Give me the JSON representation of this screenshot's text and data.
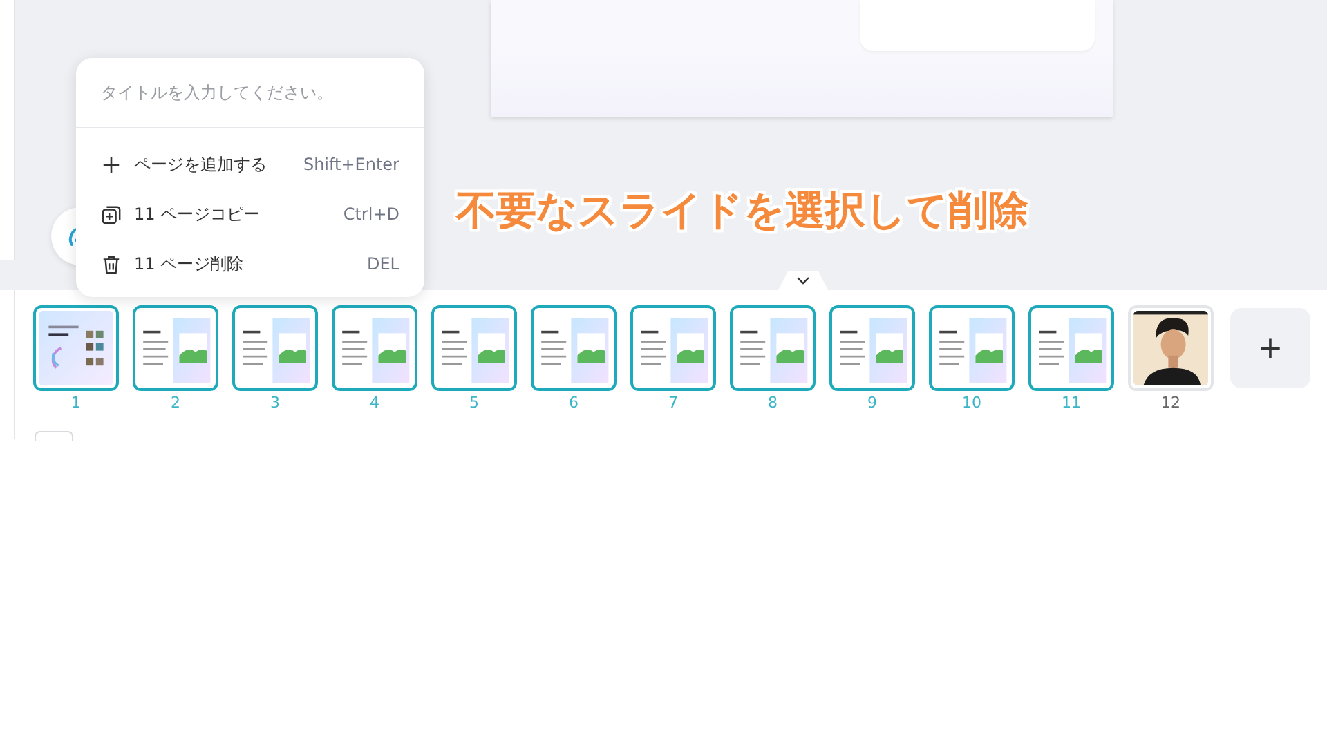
{
  "menu": {
    "title_field": {
      "placeholder": "タイトルを入力してください。"
    },
    "items": [
      {
        "kind": "add",
        "label": "ページを追加する",
        "shortcut": "Shift+Enter"
      },
      {
        "kind": "copy",
        "label": "11 ページコピー",
        "shortcut": "Ctrl+D"
      },
      {
        "kind": "delete",
        "label": "11 ページ削除",
        "shortcut": "DEL"
      }
    ]
  },
  "annotation": "不要なスライドを選択して削除",
  "slides": [
    {
      "number": "1",
      "kind": "cover",
      "selected": true
    },
    {
      "number": "2",
      "kind": "content",
      "selected": true
    },
    {
      "number": "3",
      "kind": "content",
      "selected": true
    },
    {
      "number": "4",
      "kind": "content",
      "selected": true
    },
    {
      "number": "5",
      "kind": "content",
      "selected": true
    },
    {
      "number": "6",
      "kind": "content",
      "selected": true
    },
    {
      "number": "7",
      "kind": "content",
      "selected": true
    },
    {
      "number": "8",
      "kind": "content",
      "selected": true
    },
    {
      "number": "9",
      "kind": "content",
      "selected": true
    },
    {
      "number": "10",
      "kind": "content",
      "selected": true
    },
    {
      "number": "11",
      "kind": "content",
      "selected": true
    },
    {
      "number": "12",
      "kind": "picture",
      "selected": false
    }
  ],
  "add_button": {
    "label": "+"
  }
}
